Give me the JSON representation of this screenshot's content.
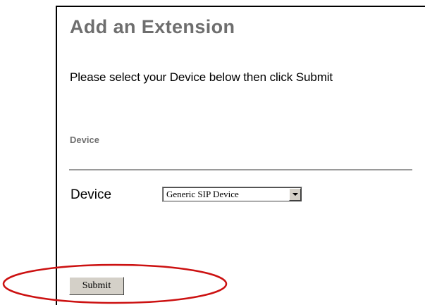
{
  "page": {
    "title": "Add an Extension",
    "instructions": "Please select your Device below then click Submit"
  },
  "section": {
    "heading": "Device"
  },
  "form": {
    "device_label": "Device",
    "device_select": {
      "selected": "Generic SIP Device"
    },
    "submit_label": "Submit"
  },
  "colors": {
    "title": "#6e6e6e",
    "section_heading": "#707070",
    "divider": "#9a9a9a",
    "button_face": "#d4d0c8",
    "annotation": "#cc1111"
  },
  "annotation": {
    "shape": "ellipse",
    "target": "submit-button"
  }
}
